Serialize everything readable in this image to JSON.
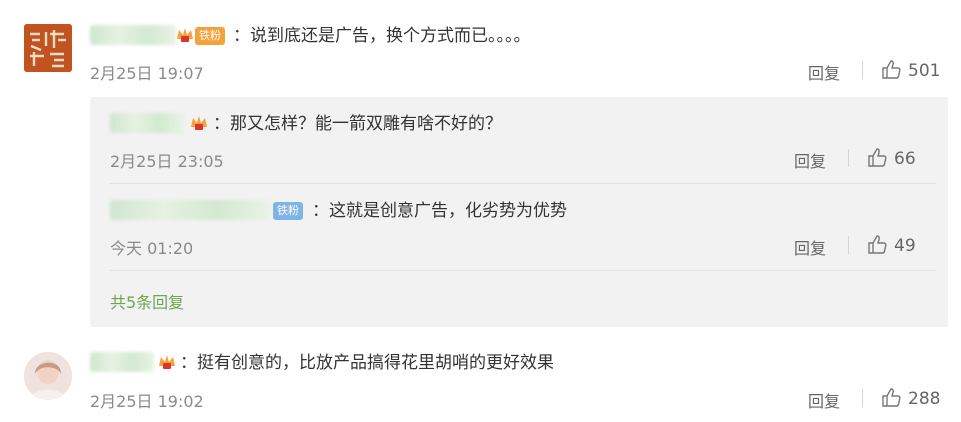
{
  "comments": [
    {
      "text": "：说到底还是广告，换个方式而已。。。。",
      "badge": "铁粉",
      "time": "2月25日 19:07",
      "reply_label": "回复",
      "likes": "501"
    },
    {
      "text": "：挺有创意的，比放产品搞得花里胡哨的更好效果",
      "time": "2月25日 19:02",
      "reply_label": "回复",
      "likes": "288"
    }
  ],
  "replies": [
    {
      "text": "：那又怎样？能一箭双雕有啥不好的？",
      "time": "2月25日 23:05",
      "reply_label": "回复",
      "likes": "66"
    },
    {
      "text": "：这就是创意广告，化劣势为优势",
      "badge": "铁粉",
      "time": "今天 01:20",
      "reply_label": "回复",
      "likes": "49"
    }
  ],
  "more_replies": "共5条回复",
  "colors": {
    "link_green": "#6aa84f",
    "badge_orange": "#f5a23a",
    "badge_blue": "#7fb4e8"
  }
}
